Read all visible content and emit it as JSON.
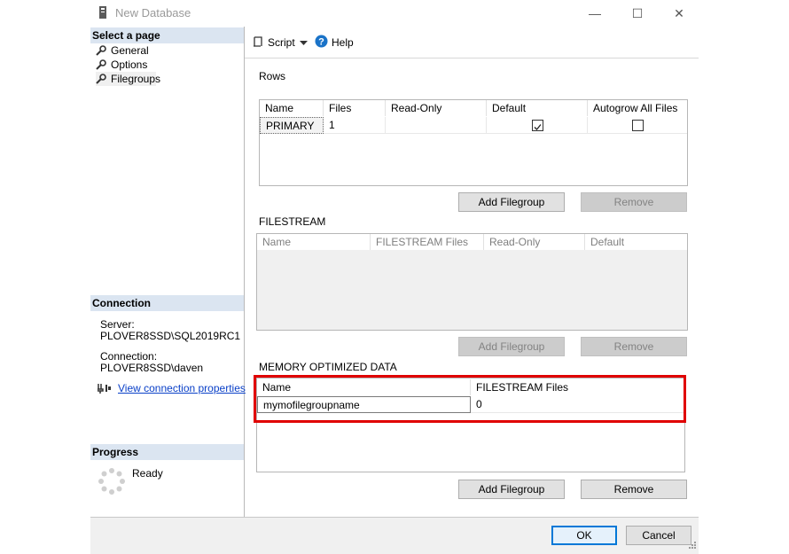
{
  "window": {
    "title": "New Database"
  },
  "titlebar_buttons": {
    "minimize": "—",
    "maximize": "☐",
    "close": "✕"
  },
  "select_page": {
    "header": "Select a page",
    "items": [
      {
        "label": "General"
      },
      {
        "label": "Options"
      },
      {
        "label": "Filegroups"
      }
    ]
  },
  "connection": {
    "header": "Connection",
    "server_label": "Server:",
    "server_value": "PLOVER8SSD\\SQL2019RC1",
    "connection_label": "Connection:",
    "connection_value": "PLOVER8SSD\\daven",
    "view_link": "View connection properties"
  },
  "progress": {
    "header": "Progress",
    "status": "Ready"
  },
  "toolbar": {
    "script_label": "Script",
    "help_label": "Help"
  },
  "rows_section": {
    "label": "Rows",
    "columns": [
      "Name",
      "Files",
      "Read-Only",
      "Default",
      "Autogrow All Files"
    ],
    "rows": [
      {
        "name": "PRIMARY",
        "files": "1",
        "read_only": false,
        "default": true,
        "autogrow": false
      }
    ],
    "add_button": "Add Filegroup",
    "remove_button": "Remove"
  },
  "filestream_section": {
    "label": "FILESTREAM",
    "columns": [
      "Name",
      "FILESTREAM Files",
      "Read-Only",
      "Default"
    ],
    "add_button": "Add Filegroup",
    "remove_button": "Remove"
  },
  "memory_section": {
    "label": "MEMORY OPTIMIZED DATA",
    "columns": [
      "Name",
      "FILESTREAM Files"
    ],
    "rows": [
      {
        "name": "mymofilegroupname",
        "files": "0"
      }
    ],
    "add_button": "Add Filegroup",
    "remove_button": "Remove"
  },
  "footer": {
    "ok_label": "OK",
    "cancel_label": "Cancel"
  },
  "colors": {
    "section_header_bg": "#dbe5f1",
    "highlight": "#e00000",
    "link": "#0a40c8"
  }
}
